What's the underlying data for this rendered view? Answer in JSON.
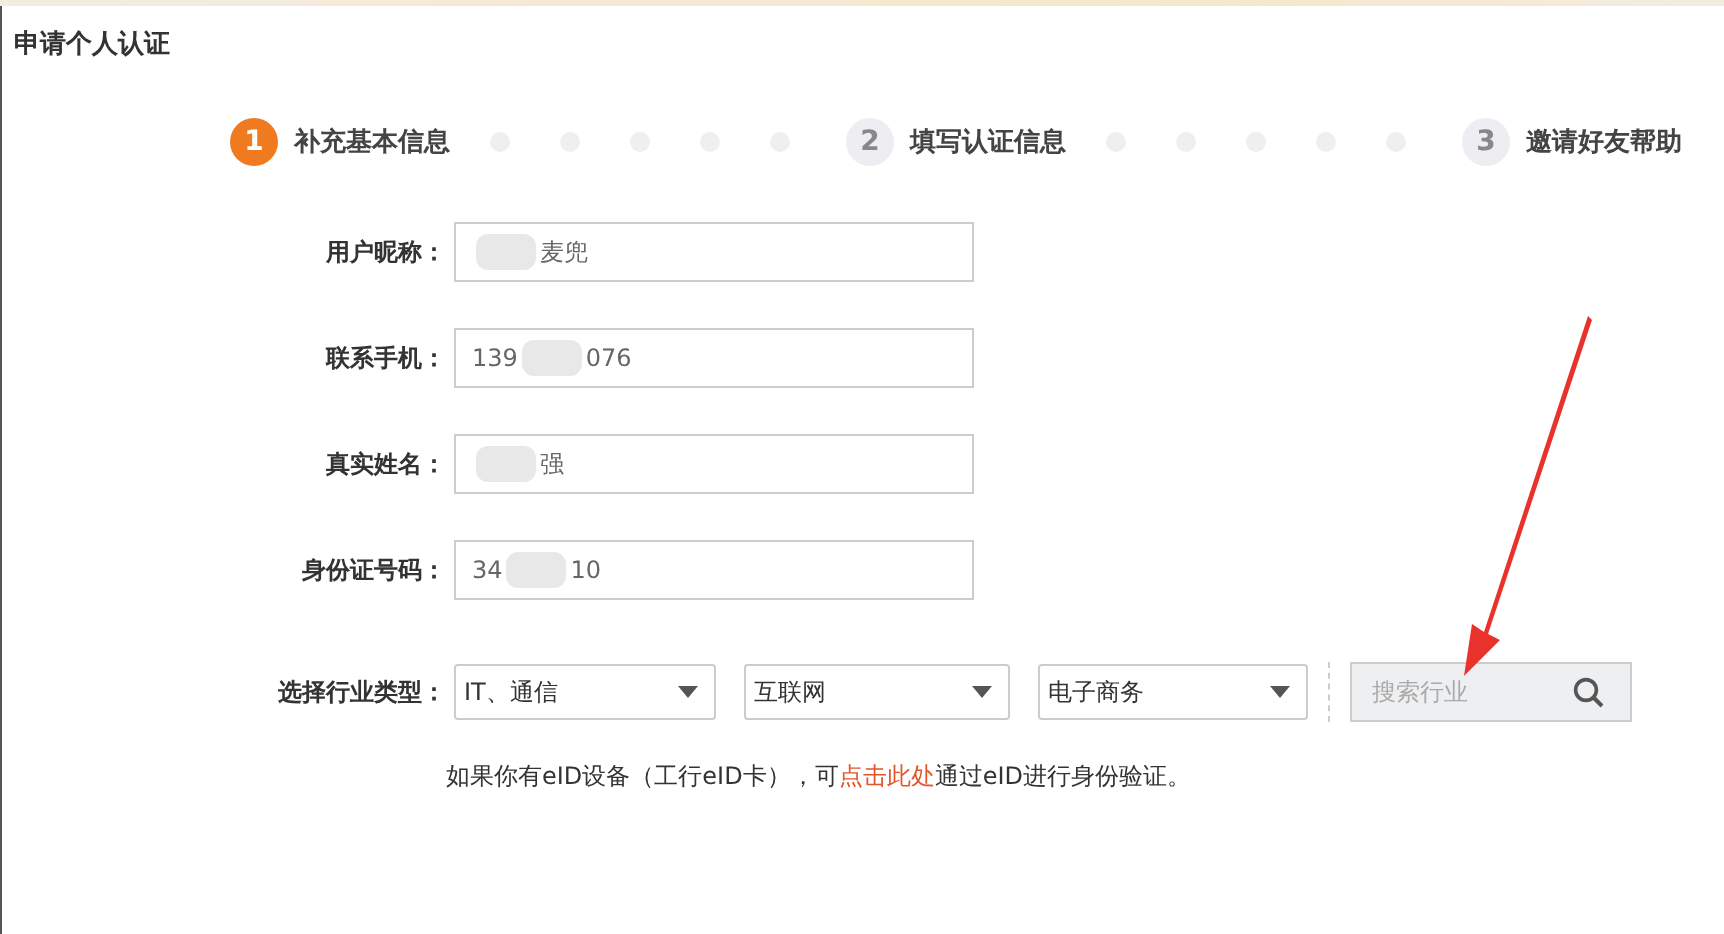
{
  "window": {
    "title": "申请个人认证"
  },
  "steps": [
    {
      "number": "1",
      "label": "补充基本信息",
      "selected": true
    },
    {
      "number": "2",
      "label": "填写认证信息",
      "selected": false
    },
    {
      "number": "3",
      "label": "邀请好友帮助",
      "selected": false
    }
  ],
  "fields": [
    {
      "label": "用户昵称：",
      "value_end": "麦兜"
    },
    {
      "label": "联系手机：",
      "value_start": "139",
      "value_end": "076"
    },
    {
      "label": "真实姓名：",
      "value_end": "强"
    },
    {
      "label": "身份证号码：",
      "value_start": "34",
      "value_end": "10"
    }
  ],
  "industry": {
    "label": "选择行业类型：",
    "selects": [
      "IT、通信",
      "互联网",
      "电子商务"
    ],
    "search": {
      "placeholder": "搜索行业"
    }
  },
  "note": {
    "before": "如果你有eID设备（工行eID卡），可",
    "link": "点击此处",
    "after": "通过eID进行身份验证。"
  }
}
